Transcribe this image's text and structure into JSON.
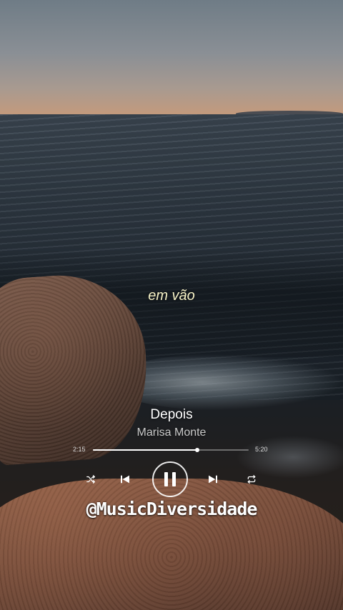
{
  "lyric": "em vão",
  "song": {
    "title": "Depois",
    "artist": "Marisa Monte"
  },
  "playback": {
    "elapsed": "2:15",
    "total": "5:20",
    "progress_fraction": 0.67
  },
  "controls": {
    "shuffle_icon": "shuffle-icon",
    "previous_icon": "skip-previous-icon",
    "play_pause_icon": "pause-icon",
    "next_icon": "skip-next-icon",
    "repeat_icon": "repeat-icon"
  },
  "watermark": "@MusicDiversidade",
  "colors": {
    "lyric": "#f5f1c6",
    "text": "#ffffff",
    "artist": "#c9c9c9"
  }
}
